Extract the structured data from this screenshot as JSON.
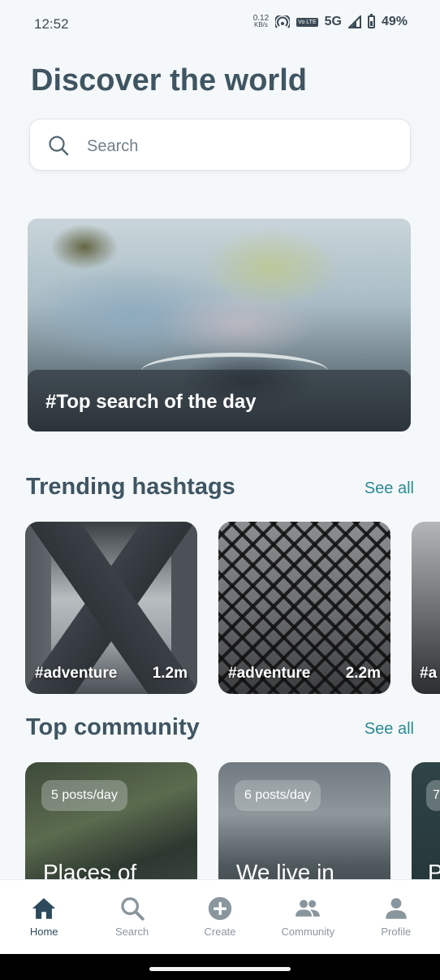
{
  "status_bar": {
    "time": "12:52",
    "net_speed": "0.12",
    "net_unit": "KB/s",
    "volte": "Vo LTE",
    "network": "5G",
    "battery": "49%"
  },
  "page": {
    "title": "Discover the world"
  },
  "search": {
    "placeholder": "Search",
    "icon": "search-icon"
  },
  "hero": {
    "label": "#Top search of the day"
  },
  "trending": {
    "title": "Trending hashtags",
    "see_all": "See all",
    "cards": [
      {
        "tag": "#adventure",
        "count": "1.2m"
      },
      {
        "tag": "#adventure",
        "count": "2.2m"
      },
      {
        "tag": "#a",
        "count": ""
      }
    ]
  },
  "community": {
    "title": "Top community",
    "see_all": "See all",
    "cards": [
      {
        "badge": "5 posts/day",
        "name": "Places of"
      },
      {
        "badge": "6 posts/day",
        "name": "We live in"
      },
      {
        "badge": "7",
        "name": "P"
      }
    ]
  },
  "nav": {
    "items": [
      {
        "label": "Home",
        "icon": "home-icon",
        "active": true
      },
      {
        "label": "Search",
        "icon": "search-icon",
        "active": false
      },
      {
        "label": "Create",
        "icon": "plus-circle-icon",
        "active": false
      },
      {
        "label": "Community",
        "icon": "people-icon",
        "active": false
      },
      {
        "label": "Profile",
        "icon": "person-icon",
        "active": false
      }
    ]
  },
  "colors": {
    "background": "#f5f8fa",
    "heading": "#3f5562",
    "accent": "#2a8a93",
    "nav_active": "#2d4a5c",
    "nav_inactive": "#8a969e"
  }
}
